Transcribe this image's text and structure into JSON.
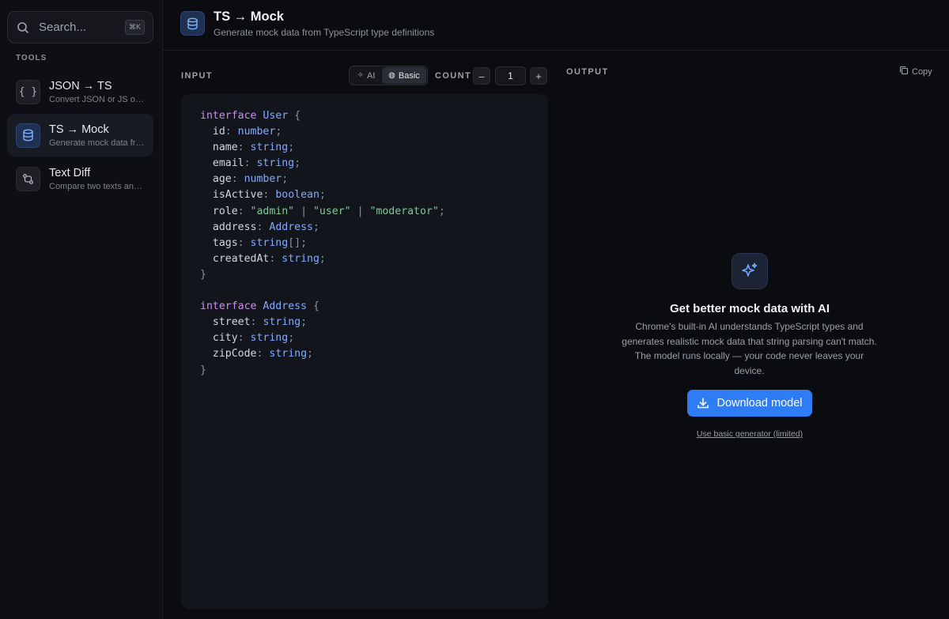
{
  "sidebar": {
    "search": {
      "placeholder": "Search...",
      "shortcut": "⌘K"
    },
    "section_label": "TOOLS",
    "items": [
      {
        "icon": "braces-icon",
        "glyph": "{ }",
        "title": "JSON → TS",
        "subtitle": "Convert JSON or JS objects to TypeScript"
      },
      {
        "icon": "database-icon",
        "title": "TS → Mock",
        "subtitle": "Generate mock data from TypeScript",
        "active": true
      },
      {
        "icon": "git-compare-icon",
        "title": "Text Diff",
        "subtitle": "Compare two texts and see differences"
      }
    ]
  },
  "header": {
    "title": "TS → Mock",
    "subtitle": "Generate mock data from TypeScript type definitions"
  },
  "input": {
    "label": "INPUT",
    "mode_ai_label": "AI",
    "mode_basic_label": "Basic",
    "selected_mode": "Basic",
    "count_label": "COUNT",
    "decrement_label": "–",
    "increment_label": "+",
    "count_value": "1",
    "code_lines": [
      "interface User {",
      "  id: number;",
      "  name: string;",
      "  email: string;",
      "  age: number;",
      "  isActive: boolean;",
      "  role: \"admin\" | \"user\" | \"moderator\";",
      "  address: Address;",
      "  tags: string[];",
      "  createdAt: string;",
      "}",
      "",
      "interface Address {",
      "  street: string;",
      "  city: string;",
      "  zipCode: string;",
      "}"
    ]
  },
  "output": {
    "label": "OUTPUT",
    "copy_label": "Copy",
    "ai_title": "Get better mock data with AI",
    "ai_description": "Chrome's built-in AI understands TypeScript types and generates realistic mock data that string parsing can't match. The model runs locally — your code never leaves your device.",
    "download_label": "Download model",
    "basic_link_label": "Use basic generator (limited)"
  },
  "colors": {
    "accent": "#2f7df6",
    "keyword": "#c792ea",
    "type": "#82aaff",
    "string": "#7ec699"
  }
}
